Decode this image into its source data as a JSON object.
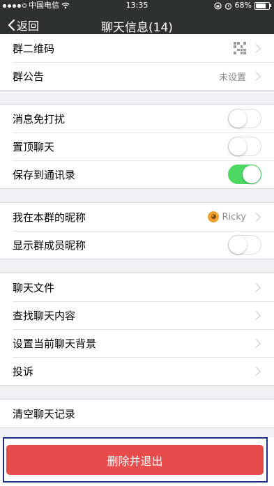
{
  "status_bar": {
    "carrier": "中国电信",
    "time": "13:35",
    "battery": "68%"
  },
  "nav": {
    "back_label": "返回",
    "title": "聊天信息(14)"
  },
  "groups": [
    {
      "rows": [
        {
          "label": "群二维码",
          "type": "qr"
        },
        {
          "label": "群公告",
          "value": "未设置",
          "type": "link"
        }
      ]
    },
    {
      "rows": [
        {
          "label": "消息免打扰",
          "type": "toggle",
          "on": false
        },
        {
          "label": "置顶聊天",
          "type": "toggle",
          "on": false
        },
        {
          "label": "保存到通讯录",
          "type": "toggle",
          "on": true
        }
      ]
    },
    {
      "rows": [
        {
          "label": "我在本群的昵称",
          "value": "Ricky",
          "type": "link",
          "icon": "lion-avatar-icon"
        },
        {
          "label": "显示群成员昵称",
          "type": "toggle",
          "on": false
        }
      ]
    },
    {
      "rows": [
        {
          "label": "聊天文件",
          "type": "link"
        },
        {
          "label": "查找聊天内容",
          "type": "link"
        },
        {
          "label": "设置当前聊天背景",
          "type": "link"
        },
        {
          "label": "投诉",
          "type": "link"
        }
      ]
    },
    {
      "rows": [
        {
          "label": "清空聊天记录",
          "type": "plain"
        }
      ]
    }
  ],
  "delete_button": {
    "label": "删除并退出"
  },
  "colors": {
    "nav_bg": "#2e3132",
    "toggle_on": "#4cd964",
    "delete_bg": "#e64c4c",
    "highlight_frame": "#1f2e8c"
  }
}
